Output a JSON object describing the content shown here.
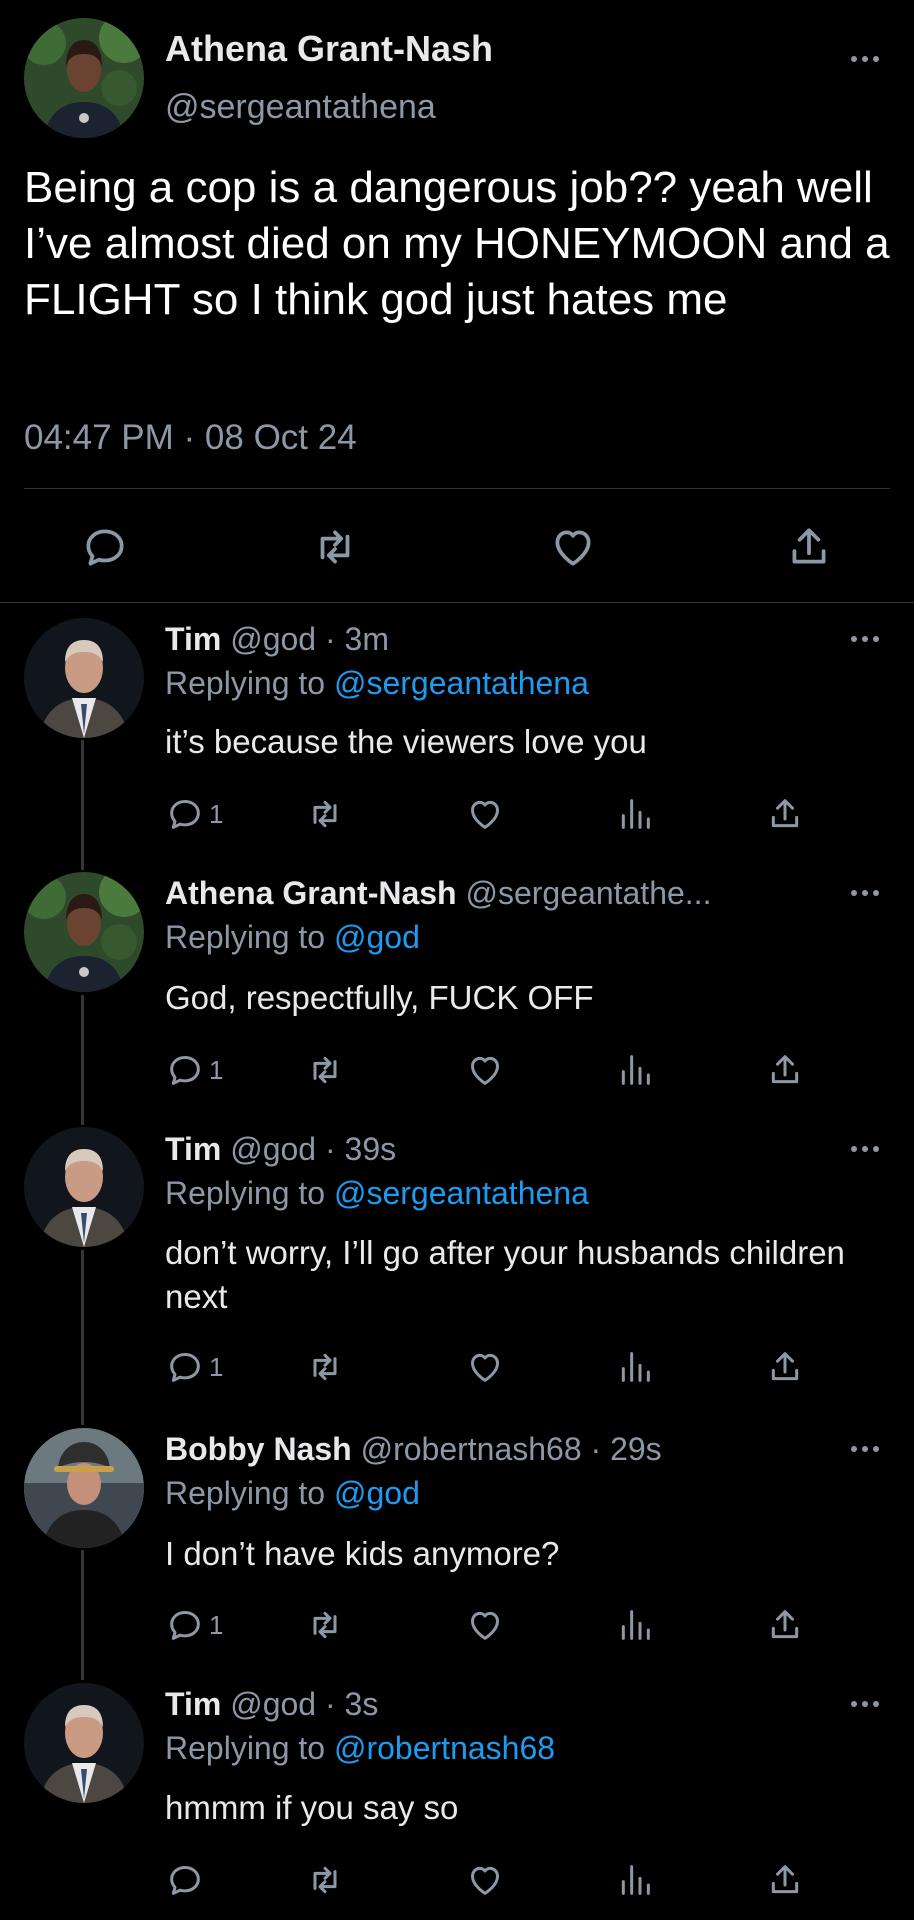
{
  "main_tweet": {
    "name": "Athena Grant-Nash",
    "handle": "@sergeantathena",
    "text": "Being a cop is a dangerous job?? yeah well I’ve almost died on my HONEYMOON and a FLIGHT so I think god just hates me",
    "timestamp": "04:47 PM · 08 Oct 24",
    "actions": [
      "reply-icon",
      "retweet-icon",
      "like-icon",
      "share-icon"
    ]
  },
  "replies": [
    {
      "name": "Tim",
      "meta": "@god · 3m",
      "replying_prefix": "Replying to ",
      "replying_to": "@sergeantathena",
      "text": "it’s because the viewers love you",
      "reply_count": "1",
      "avatar": "tim-avatar"
    },
    {
      "name": "Athena Grant-Nash",
      "meta": "@sergeantathe...",
      "replying_prefix": "Replying to ",
      "replying_to": "@god",
      "text": "God, respectfully, FUCK OFF",
      "reply_count": "1",
      "avatar": "athena-avatar"
    },
    {
      "name": "Tim",
      "meta": "@god · 39s",
      "replying_prefix": "Replying to ",
      "replying_to": "@sergeantathena",
      "text": "don’t worry, I’ll go after your husbands children next",
      "reply_count": "1",
      "avatar": "tim-avatar"
    },
    {
      "name": "Bobby Nash",
      "meta": "@robertnash68 · 29s",
      "replying_prefix": "Replying to ",
      "replying_to": "@god",
      "text": "I don’t have kids anymore?",
      "reply_count": "1",
      "avatar": "bobby-avatar"
    },
    {
      "name": "Tim",
      "meta": "@god · 3s",
      "replying_prefix": "Replying to ",
      "replying_to": "@robertnash68",
      "text": "hmmm if you say so",
      "reply_count": "",
      "avatar": "tim-avatar"
    }
  ],
  "colors": {
    "background": "#000000",
    "text": "#e7e9ea",
    "secondary": "#8b98a5",
    "link": "#1d9bf0",
    "divider": "#2f3336"
  }
}
